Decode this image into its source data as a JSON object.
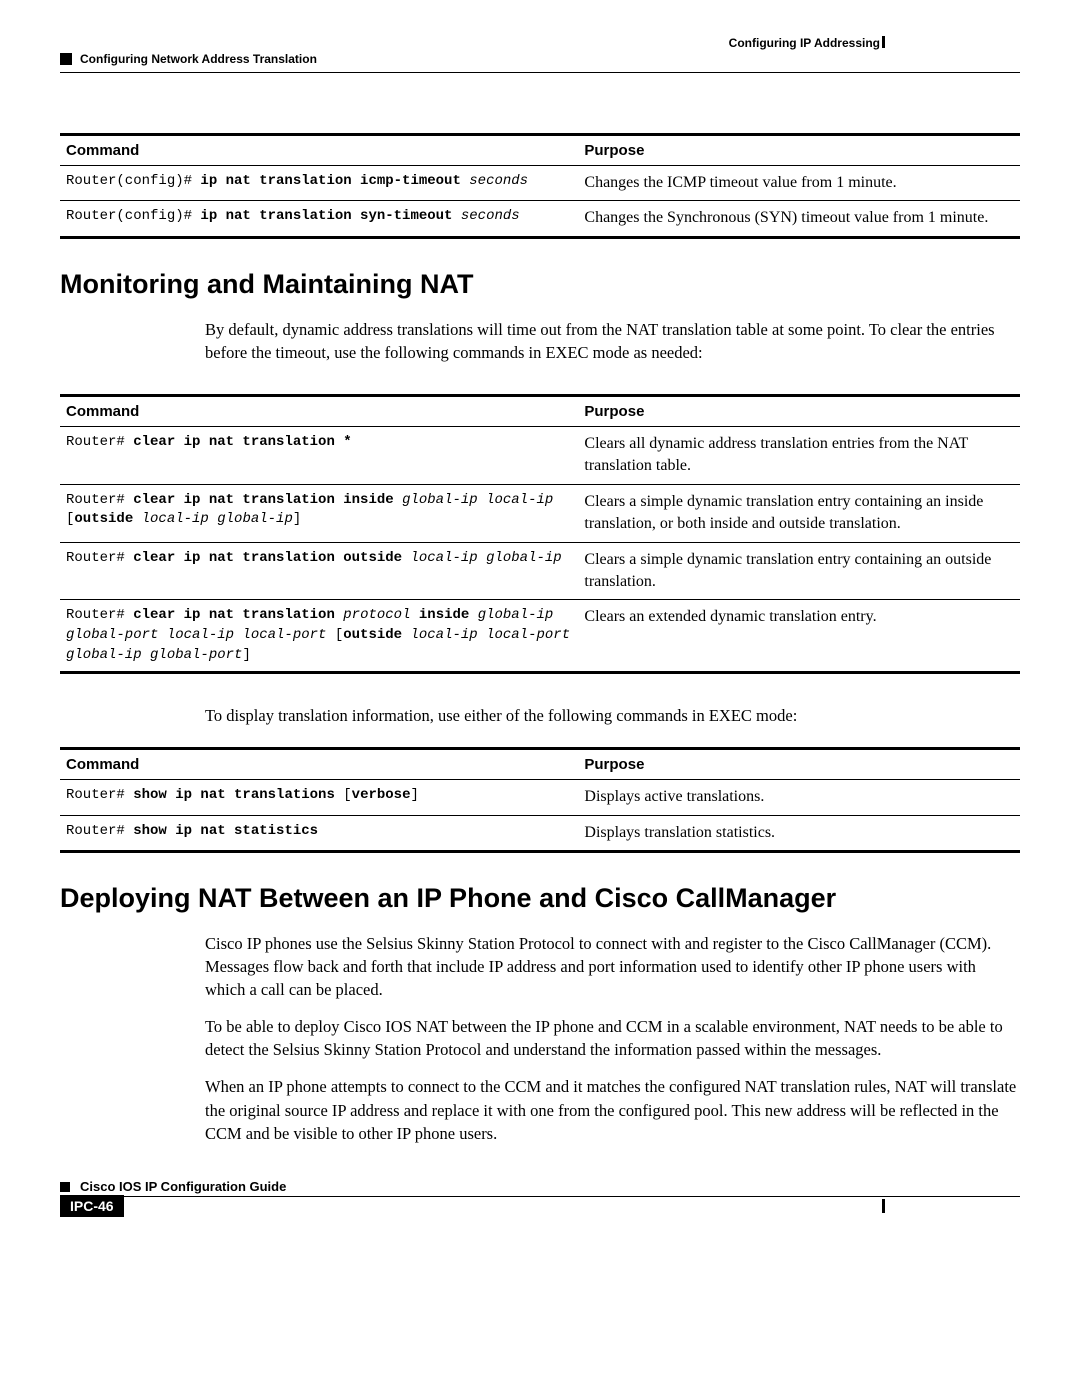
{
  "header": {
    "right": "Configuring IP Addressing",
    "left": "Configuring Network Address Translation"
  },
  "table1": {
    "headers": {
      "cmd": "Command",
      "purpose": "Purpose"
    },
    "rows": [
      {
        "prompt": "Router(config)# ",
        "bold": "ip nat translation icmp-timeout ",
        "ital": "seconds",
        "purpose": "Changes the ICMP timeout value from 1 minute."
      },
      {
        "prompt": "Router(config)# ",
        "bold": "ip nat translation syn-timeout ",
        "ital": "seconds",
        "purpose": "Changes the Synchronous (SYN) timeout value from 1 minute."
      }
    ]
  },
  "section1": {
    "title": "Monitoring and Maintaining NAT",
    "para": "By default, dynamic address translations will time out from the NAT translation table at some point. To clear the entries before the timeout, use the following commands in EXEC mode as needed:"
  },
  "table2": {
    "headers": {
      "cmd": "Command",
      "purpose": "Purpose"
    },
    "rows": [
      {
        "prompt": "Router# ",
        "bold": "clear ip nat translation *",
        "ital": "",
        "purpose": "Clears all dynamic address translation entries from the NAT translation table."
      },
      {
        "prompt": "Router# ",
        "seg": [
          {
            "b": "clear ip nat translation inside "
          },
          {
            "i": "global-ip local-ip "
          },
          {
            "t": "["
          },
          {
            "b": "outside "
          },
          {
            "i": "local-ip global-ip"
          },
          {
            "t": "]"
          }
        ],
        "purpose": "Clears a simple dynamic translation entry containing an inside translation, or both inside and outside translation."
      },
      {
        "prompt": "Router# ",
        "seg": [
          {
            "b": "clear ip nat translation outside "
          },
          {
            "i": "local-ip global-ip"
          }
        ],
        "purpose": "Clears a simple dynamic translation entry containing an outside translation."
      },
      {
        "prompt": "Router# ",
        "seg": [
          {
            "b": "clear ip nat translation "
          },
          {
            "i": "protocol "
          },
          {
            "b": "inside "
          },
          {
            "i": "global-ip global-port local-ip local-port "
          },
          {
            "t": "["
          },
          {
            "b": "outside "
          },
          {
            "i": "local-ip local-port global-ip global-port"
          },
          {
            "t": "]"
          }
        ],
        "purpose": "Clears an extended dynamic translation entry."
      }
    ]
  },
  "mid_para": "To display translation information, use either of the following commands in EXEC mode:",
  "table3": {
    "headers": {
      "cmd": "Command",
      "purpose": "Purpose"
    },
    "rows": [
      {
        "prompt": "Router# ",
        "seg": [
          {
            "b": "show ip nat translations "
          },
          {
            "t": "["
          },
          {
            "b": "verbose"
          },
          {
            "t": "]"
          }
        ],
        "purpose": "Displays active translations."
      },
      {
        "prompt": "Router# ",
        "bold": "show ip nat statistics",
        "ital": "",
        "purpose": "Displays translation statistics."
      }
    ]
  },
  "section2": {
    "title": "Deploying NAT Between an IP Phone and Cisco CallManager",
    "p1": "Cisco IP phones use the Selsius Skinny Station Protocol to connect with and register to the Cisco CallManager (CCM). Messages flow back and forth that include IP address and port information used to identify other IP phone users with which a call can be placed.",
    "p2": "To be able to deploy Cisco IOS NAT between the IP phone and CCM in a scalable environment, NAT needs to be able to detect the Selsius Skinny Station Protocol and understand the information passed within the messages.",
    "p3": "When an IP phone attempts to connect to the CCM and it matches the configured NAT translation rules, NAT will translate the original source IP address and replace it with one from the configured pool. This new address will be reflected in the CCM and be visible to other IP phone users."
  },
  "footer": {
    "title": "Cisco IOS IP Configuration Guide",
    "page": "IPC-46"
  }
}
